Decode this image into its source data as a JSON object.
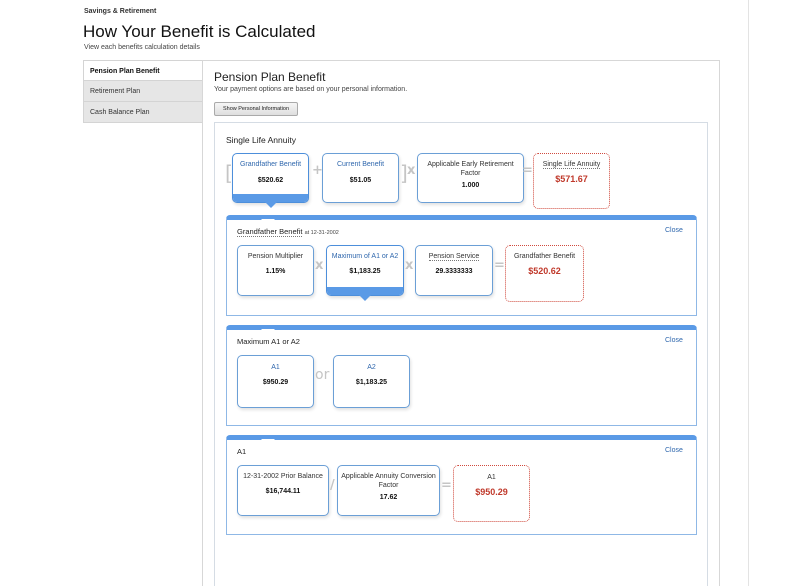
{
  "header": {
    "section": "Savings & Retirement",
    "title": "How Your Benefit is Calculated",
    "subtitle": "View each benefits calculation details"
  },
  "sidebar": {
    "items": [
      {
        "label": "Pension Plan Benefit",
        "active": true
      },
      {
        "label": "Retirement Plan",
        "active": false
      },
      {
        "label": "Cash Balance Plan",
        "active": false
      }
    ]
  },
  "main": {
    "title": "Pension Plan Benefit",
    "subtitle": "Your payment options are based on your personal information.",
    "show_button": "Show Personal Information",
    "annuity": {
      "heading": "Single Life Annuity",
      "grandfather": {
        "label": "Grandfather Benefit",
        "value": "$520.62"
      },
      "current": {
        "label": "Current Benefit",
        "value": "$51.05"
      },
      "factor": {
        "label": "Applicable Early Retirement Factor",
        "value": "1.000"
      },
      "result": {
        "label": "Single Life Annuity",
        "value": "$571.67"
      }
    },
    "grandfather_detail": {
      "title": "Grandfather Benefit",
      "date": "at 12-31-2002",
      "close": "Close",
      "multiplier": {
        "label": "Pension Multiplier",
        "value": "1.15%"
      },
      "max": {
        "label": "Maximum of A1 or A2",
        "value": "$1,183.25"
      },
      "service": {
        "label": "Pension Service",
        "value": "29.3333333"
      },
      "result": {
        "label": "Grandfather Benefit",
        "value": "$520.62"
      }
    },
    "max_detail": {
      "title": "Maximum A1 or A2",
      "close": "Close",
      "a1": {
        "label": "A1",
        "value": "$950.29"
      },
      "or": "or",
      "a2": {
        "label": "A2",
        "value": "$1,183.25"
      }
    },
    "a1_detail": {
      "title": "A1",
      "close": "Close",
      "prior": {
        "label": "12-31-2002 Prior Balance",
        "value": "$16,744.11"
      },
      "conv": {
        "label": "Applicable Annuity Conversion Factor",
        "value": "17.62"
      },
      "result": {
        "label": "A1",
        "value": "$950.29"
      }
    },
    "operators": {
      "plus": "+",
      "times": "x",
      "equals": "=",
      "divide": "/",
      "lbracket": "[",
      "rbracket": "]"
    }
  },
  "colors": {
    "accent": "#5a9ae6",
    "result_red": "#c0392b",
    "link_blue": "#2f67ad"
  }
}
